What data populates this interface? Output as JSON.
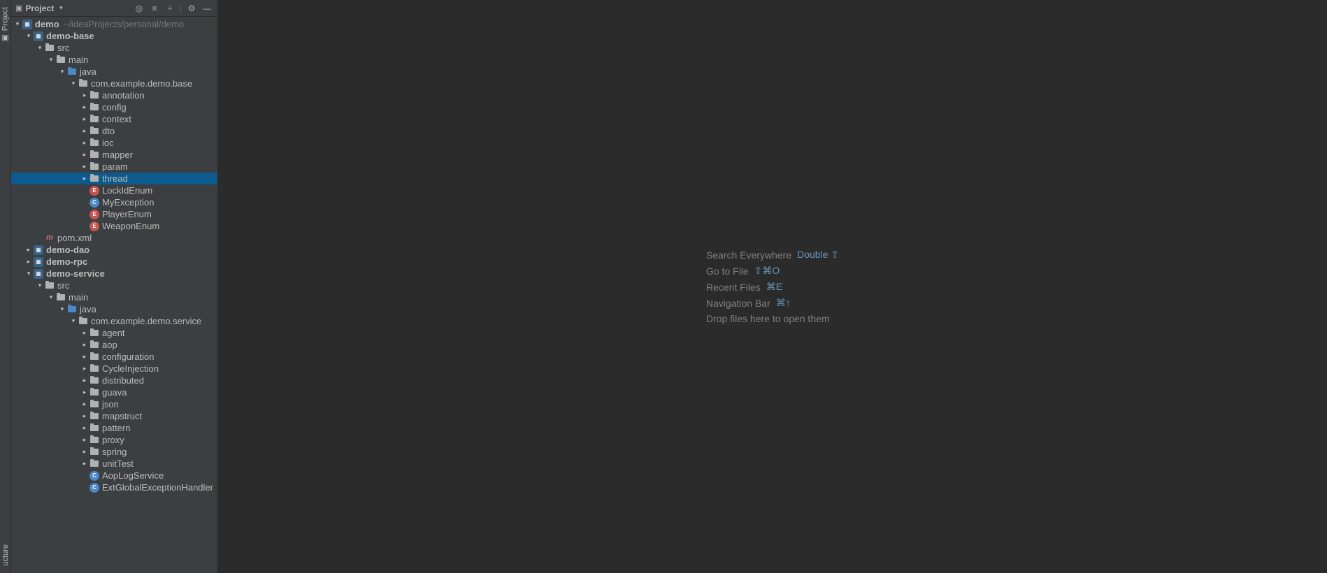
{
  "sidebarTabs": {
    "top": "Project",
    "bottom": "ucture"
  },
  "panel": {
    "title": "Project"
  },
  "emptyState": {
    "rows": [
      {
        "label": "Search Everywhere",
        "shortcut": "Double ⇧"
      },
      {
        "label": "Go to File",
        "shortcut": "⇧⌘O"
      },
      {
        "label": "Recent Files",
        "shortcut": "⌘E"
      },
      {
        "label": "Navigation Bar",
        "shortcut": "⌘↑"
      }
    ],
    "drop": "Drop files here to open them"
  },
  "tree": [
    {
      "depth": 0,
      "arrow": "down",
      "icon": "module",
      "label": "demo",
      "bold": true,
      "suffix": "~/ideaProjects/personal/demo"
    },
    {
      "depth": 1,
      "arrow": "down",
      "icon": "module",
      "label": "demo-base",
      "bold": true
    },
    {
      "depth": 2,
      "arrow": "down",
      "icon": "folder",
      "label": "src"
    },
    {
      "depth": 3,
      "arrow": "down",
      "icon": "folder",
      "label": "main"
    },
    {
      "depth": 4,
      "arrow": "down",
      "icon": "folder-src",
      "label": "java"
    },
    {
      "depth": 5,
      "arrow": "down",
      "icon": "package",
      "label": "com.example.demo.base"
    },
    {
      "depth": 6,
      "arrow": "right",
      "icon": "package",
      "label": "annotation"
    },
    {
      "depth": 6,
      "arrow": "right",
      "icon": "package",
      "label": "config"
    },
    {
      "depth": 6,
      "arrow": "right",
      "icon": "package",
      "label": "context"
    },
    {
      "depth": 6,
      "arrow": "right",
      "icon": "package",
      "label": "dto"
    },
    {
      "depth": 6,
      "arrow": "right",
      "icon": "package",
      "label": "ioc"
    },
    {
      "depth": 6,
      "arrow": "right",
      "icon": "package",
      "label": "mapper"
    },
    {
      "depth": 6,
      "arrow": "right",
      "icon": "package",
      "label": "param"
    },
    {
      "depth": 6,
      "arrow": "right",
      "icon": "package",
      "label": "thread",
      "selected": true
    },
    {
      "depth": 6,
      "arrow": "none",
      "icon": "class-e",
      "label": "LockIdEnum"
    },
    {
      "depth": 6,
      "arrow": "none",
      "icon": "class-c",
      "label": "MyException"
    },
    {
      "depth": 6,
      "arrow": "none",
      "icon": "class-e",
      "label": "PlayerEnum"
    },
    {
      "depth": 6,
      "arrow": "none",
      "icon": "class-e",
      "label": "WeaponEnum"
    },
    {
      "depth": 2,
      "arrow": "none",
      "icon": "maven",
      "label": "pom.xml"
    },
    {
      "depth": 1,
      "arrow": "right",
      "icon": "module",
      "label": "demo-dao",
      "bold": true
    },
    {
      "depth": 1,
      "arrow": "right",
      "icon": "module",
      "label": "demo-rpc",
      "bold": true
    },
    {
      "depth": 1,
      "arrow": "down",
      "icon": "module",
      "label": "demo-service",
      "bold": true
    },
    {
      "depth": 2,
      "arrow": "down",
      "icon": "folder",
      "label": "src"
    },
    {
      "depth": 3,
      "arrow": "down",
      "icon": "folder",
      "label": "main"
    },
    {
      "depth": 4,
      "arrow": "down",
      "icon": "folder-src",
      "label": "java"
    },
    {
      "depth": 5,
      "arrow": "down",
      "icon": "package",
      "label": "com.example.demo.service"
    },
    {
      "depth": 6,
      "arrow": "right",
      "icon": "package",
      "label": "agent"
    },
    {
      "depth": 6,
      "arrow": "right",
      "icon": "package",
      "label": "aop"
    },
    {
      "depth": 6,
      "arrow": "right",
      "icon": "package",
      "label": "configuration"
    },
    {
      "depth": 6,
      "arrow": "right",
      "icon": "package",
      "label": "CycleInjection"
    },
    {
      "depth": 6,
      "arrow": "right",
      "icon": "package",
      "label": "distributed"
    },
    {
      "depth": 6,
      "arrow": "right",
      "icon": "package",
      "label": "guava"
    },
    {
      "depth": 6,
      "arrow": "right",
      "icon": "package",
      "label": "json"
    },
    {
      "depth": 6,
      "arrow": "right",
      "icon": "package",
      "label": "mapstruct"
    },
    {
      "depth": 6,
      "arrow": "right",
      "icon": "package",
      "label": "pattern"
    },
    {
      "depth": 6,
      "arrow": "right",
      "icon": "package",
      "label": "proxy"
    },
    {
      "depth": 6,
      "arrow": "right",
      "icon": "package",
      "label": "spring"
    },
    {
      "depth": 6,
      "arrow": "right",
      "icon": "package",
      "label": "unitTest"
    },
    {
      "depth": 6,
      "arrow": "none",
      "icon": "class-c",
      "label": "AopLogService"
    },
    {
      "depth": 6,
      "arrow": "none",
      "icon": "class-c",
      "label": "ExtGlobalExceptionHandler"
    }
  ]
}
